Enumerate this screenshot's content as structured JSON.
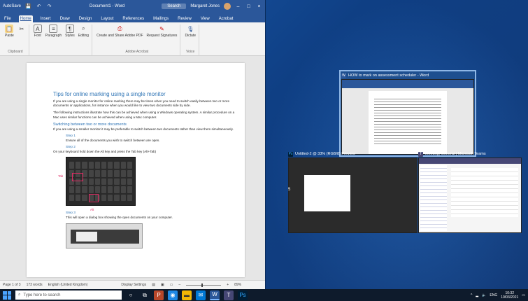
{
  "word": {
    "title": "Document1 - Word",
    "quick_access": "AutoSave",
    "user": "Margaret Jones",
    "search_placeholder": "Search",
    "tabs": [
      "File",
      "Home",
      "Insert",
      "Draw",
      "Design",
      "Layout",
      "References",
      "Mailings",
      "Review",
      "View",
      "Acrobat"
    ],
    "active_tab": "Home",
    "ribbon": {
      "paste": "Paste",
      "font": "Font",
      "paragraph": "Paragraph",
      "styles": "Styles",
      "editing": "Editing",
      "create_share_pdf": "Create and Share Adobe PDF",
      "request_signatures": "Request Signatures",
      "dictate": "Dictate",
      "group_clipboard": "Clipboard",
      "group_acrobat": "Adobe Acrobat",
      "group_voice": "Voice"
    },
    "doc": {
      "heading": "Tips for online marking using a single monitor",
      "intro": "If you are using a single monitor for online marking there may be times when you need to switch easily between two or more documents or applications, for instance when you would like to view two documents side by side.",
      "instructions": "The following instructions illustrate how this can be achieved when using a Windows operating system. A similar procedure on a Mac uses similar functions can be achieved when using a Mac computer.",
      "subheading": "Switching between two or more documents",
      "sub_text": "If you are using a smaller monitor it may be preferable to switch between two documents rather than view them simultaneously.",
      "step1_label": "Step 1",
      "step1_text": "Ensure all of the documents you wish to switch between are open.",
      "step2_label": "Step 2",
      "step2_text": "On your keyboard hold down the Alt key and press the Tab key (Alt+Tab)",
      "tab_label": "Tab",
      "alt_label": "Alt",
      "step3_label": "Step 3",
      "step3_text": "This will open a dialog box showing the open documents on your computer."
    },
    "status": {
      "page": "Page 1 of 3",
      "words": "173 words",
      "language": "English (United Kingdom)",
      "display": "Display Settings",
      "zoom": "89%"
    }
  },
  "task_view": {
    "word_thumb_title": "HOW to mark on assessment scheduler - Word",
    "pdf_thumb_title": "Untitled-2 @ 33% (RGB/8) Preview",
    "teams_thumb_title": "Meeting, General | Microsoft Teams",
    "pdf_side_number": "5"
  },
  "taskbar": {
    "search_placeholder": "Type here to search",
    "time": "10:32",
    "date": "10/03/2021",
    "lang": "ENG"
  },
  "colors": {
    "word_blue": "#2b579a",
    "accent": "#e02a63",
    "teams": "#464775"
  }
}
